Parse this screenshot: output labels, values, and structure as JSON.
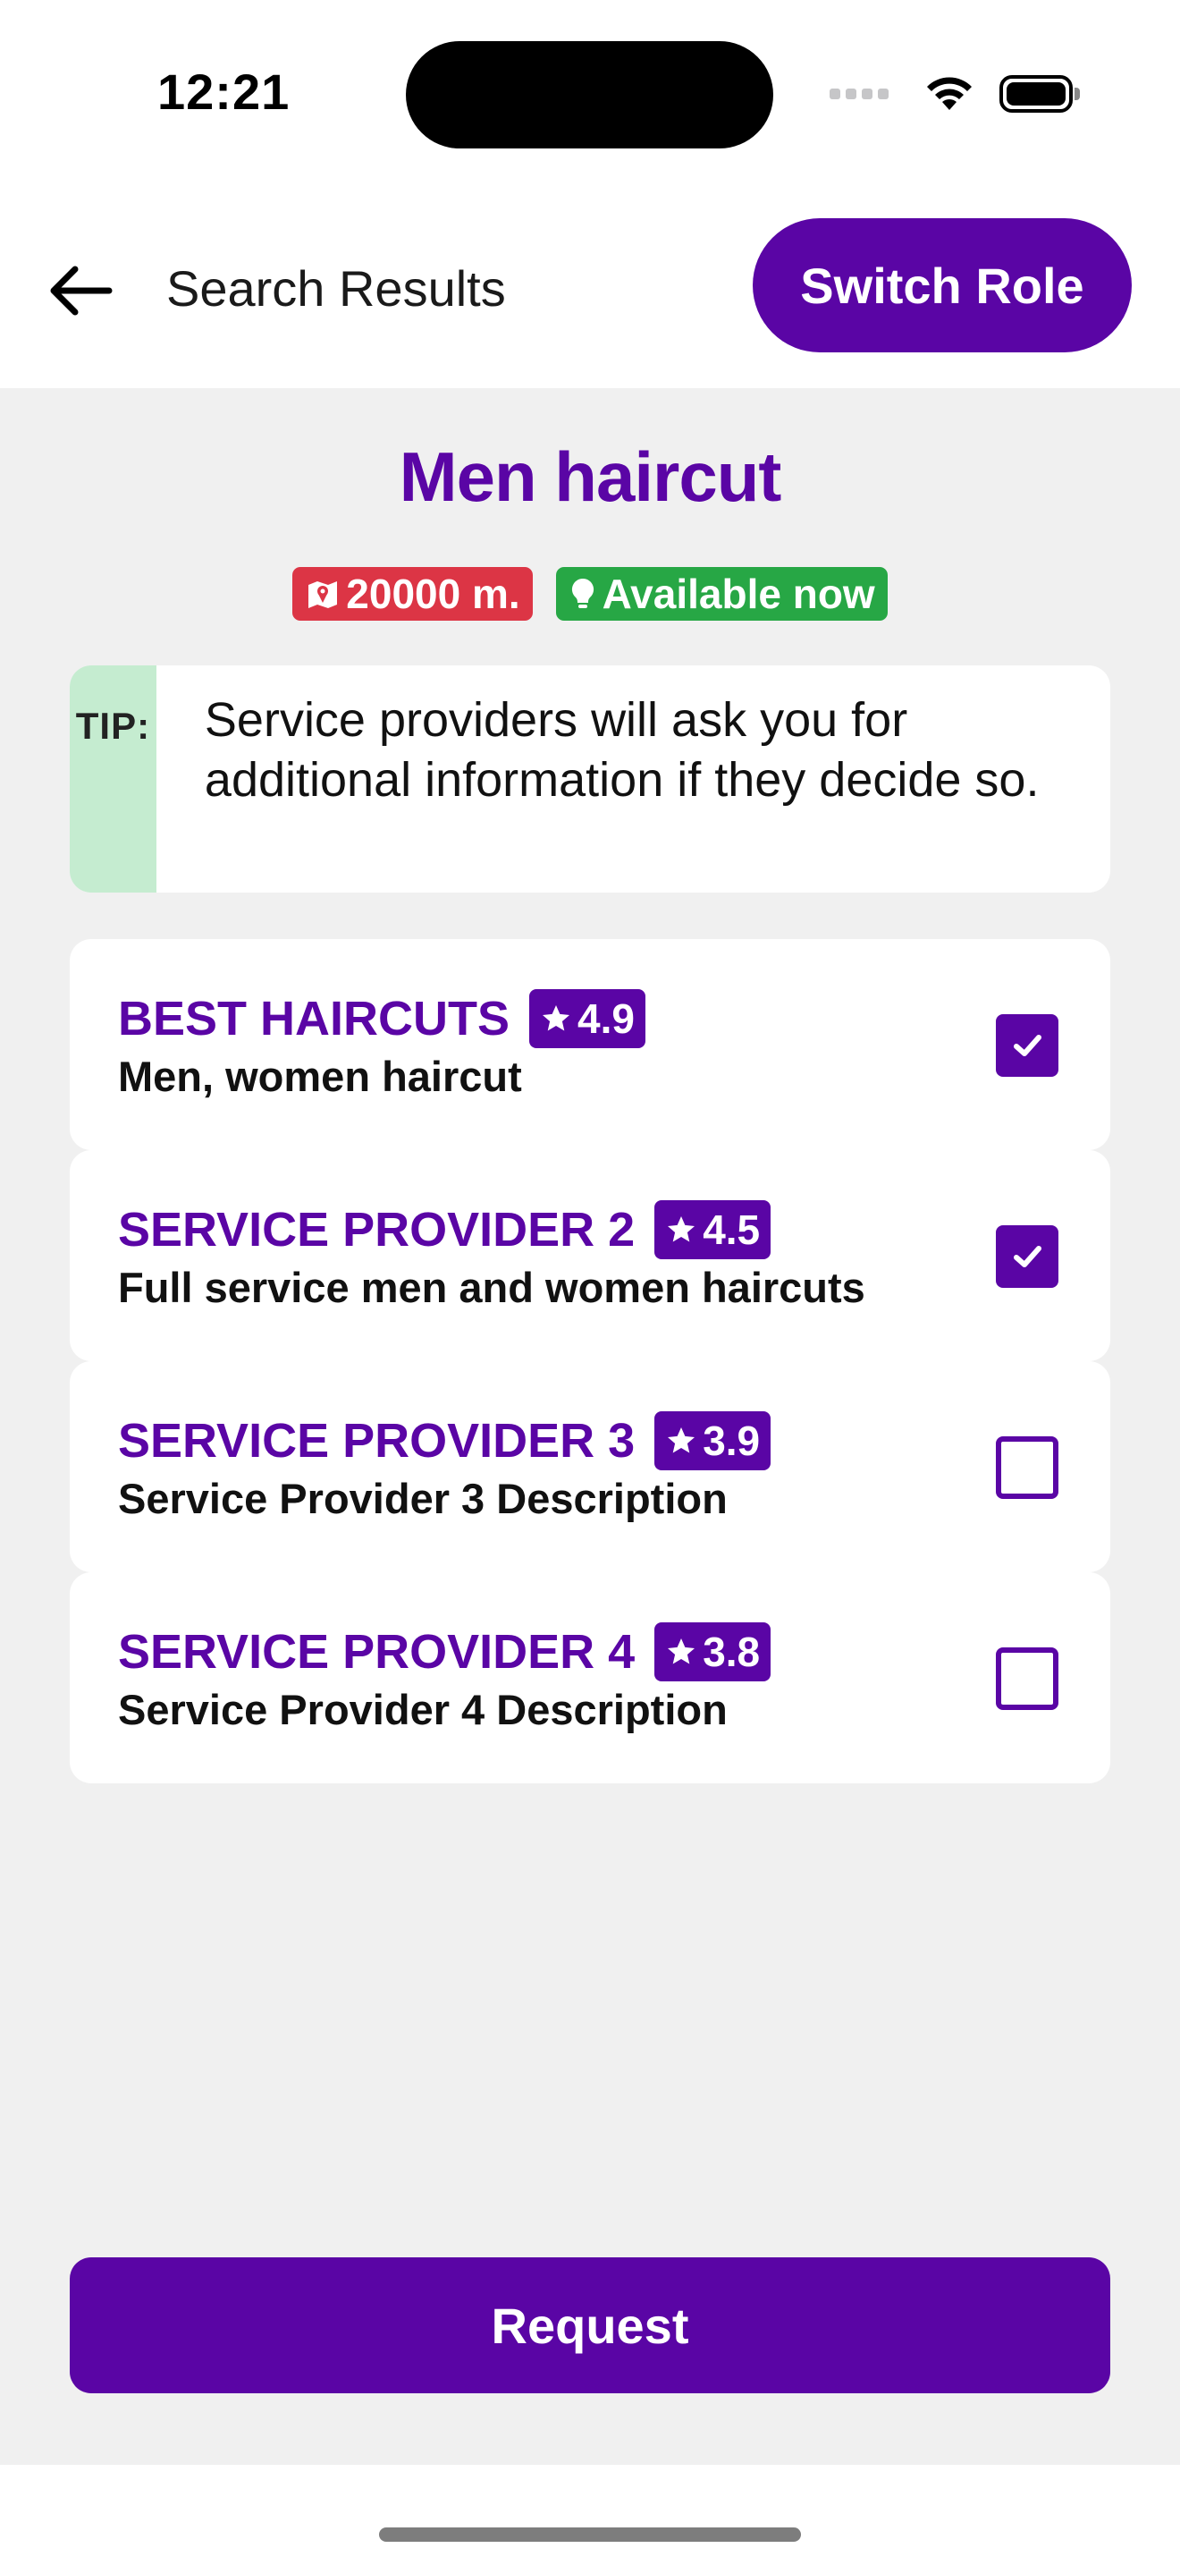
{
  "status_bar": {
    "time": "12:21"
  },
  "header": {
    "title": "Search Results",
    "switch_role_label": "Switch Role"
  },
  "service": {
    "title": "Men haircut",
    "distance": "20000 m.",
    "availability": "Available now"
  },
  "tip": {
    "label": "TIP:",
    "text": "Service providers will ask you for additional information if they decide so."
  },
  "providers": [
    {
      "name": "BEST HAIRCUTS",
      "rating": "4.9",
      "description": "Men, women haircut",
      "checked": true
    },
    {
      "name": "SERVICE PROVIDER 2",
      "rating": "4.5",
      "description": "Full service men and women haircuts",
      "checked": true
    },
    {
      "name": "SERVICE PROVIDER 3",
      "rating": "3.9",
      "description": "Service Provider 3 Description",
      "checked": false
    },
    {
      "name": "SERVICE PROVIDER 4",
      "rating": "3.8",
      "description": "Service Provider 4 Description",
      "checked": false
    }
  ],
  "actions": {
    "request_label": "Request"
  },
  "colors": {
    "primary": "#5a05a5",
    "distance_badge": "#dc3545",
    "available_badge": "#27a745",
    "tip_accent": "#c5ecd0",
    "background": "#f0f0f0"
  },
  "icons": {
    "back": "arrow-left-icon",
    "distance": "map-marker-icon",
    "available": "lightbulb-icon",
    "rating": "star-icon",
    "check": "checkmark-icon"
  }
}
